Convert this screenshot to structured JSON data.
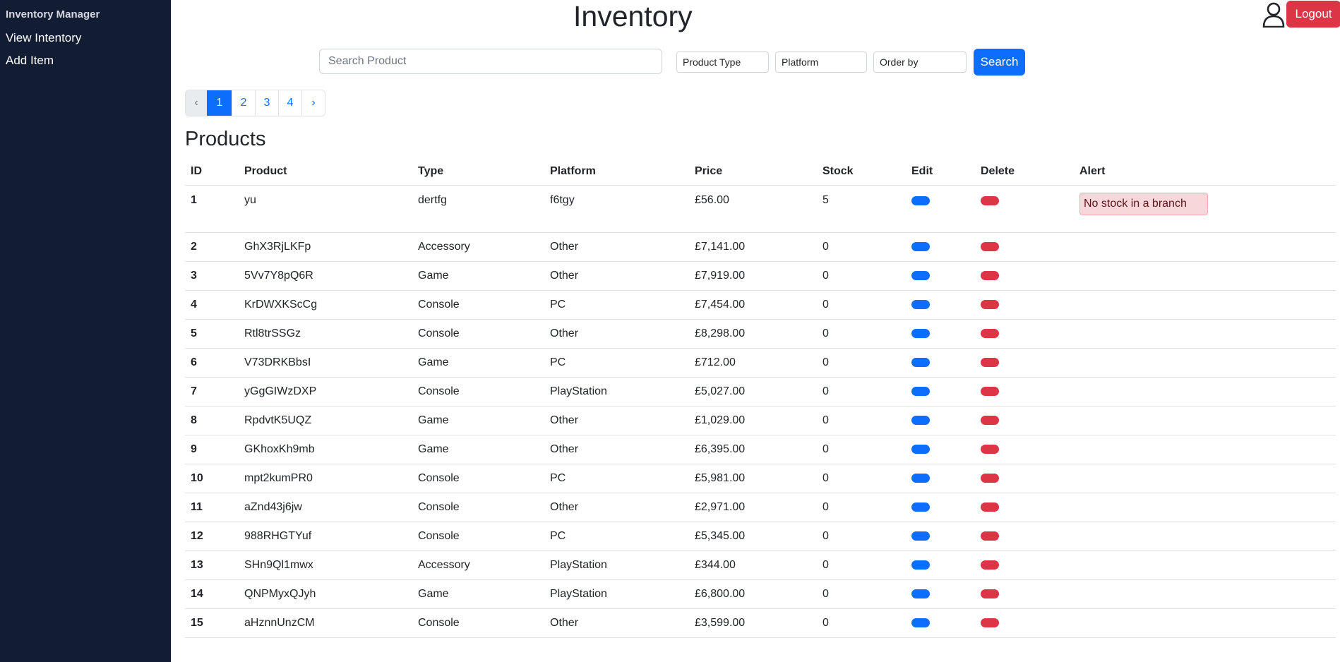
{
  "sidebar": {
    "brand": "Inventory Manager",
    "items": [
      {
        "label": "View Intentory"
      },
      {
        "label": "Add Item"
      }
    ]
  },
  "header": {
    "title": "Inventory",
    "user_icon": "person-icon",
    "logout_label": "Logout"
  },
  "search": {
    "placeholder": "Search Product",
    "value": "",
    "product_type": "Product Type",
    "platform": "Platform",
    "order_by": "Order by",
    "button_label": "Search"
  },
  "pagination": {
    "prev": "‹",
    "pages": [
      "1",
      "2",
      "3",
      "4"
    ],
    "active_page": "1",
    "next": "›"
  },
  "products": {
    "title": "Products",
    "columns": [
      "ID",
      "Product",
      "Type",
      "Platform",
      "Price",
      "Stock",
      "Edit",
      "Delete",
      "Alert"
    ],
    "rows": [
      {
        "id": "1",
        "product": "yu",
        "type": "dertfg",
        "platform": "f6tgy",
        "price": "£56.00",
        "stock": "5",
        "alert": "No stock in a branch"
      },
      {
        "id": "2",
        "product": "GhX3RjLKFp",
        "type": "Accessory",
        "platform": "Other",
        "price": "£7,141.00",
        "stock": "0",
        "alert": ""
      },
      {
        "id": "3",
        "product": "5Vv7Y8pQ6R",
        "type": "Game",
        "platform": "Other",
        "price": "£7,919.00",
        "stock": "0",
        "alert": ""
      },
      {
        "id": "4",
        "product": "KrDWXKScCg",
        "type": "Console",
        "platform": "PC",
        "price": "£7,454.00",
        "stock": "0",
        "alert": ""
      },
      {
        "id": "5",
        "product": "Rtl8trSSGz",
        "type": "Console",
        "platform": "Other",
        "price": "£8,298.00",
        "stock": "0",
        "alert": ""
      },
      {
        "id": "6",
        "product": "V73DRKBbsI",
        "type": "Game",
        "platform": "PC",
        "price": "£712.00",
        "stock": "0",
        "alert": ""
      },
      {
        "id": "7",
        "product": "yGgGIWzDXP",
        "type": "Console",
        "platform": "PlayStation",
        "price": "£5,027.00",
        "stock": "0",
        "alert": ""
      },
      {
        "id": "8",
        "product": "RpdvtK5UQZ",
        "type": "Game",
        "platform": "Other",
        "price": "£1,029.00",
        "stock": "0",
        "alert": ""
      },
      {
        "id": "9",
        "product": "GKhoxKh9mb",
        "type": "Game",
        "platform": "Other",
        "price": "£6,395.00",
        "stock": "0",
        "alert": ""
      },
      {
        "id": "10",
        "product": "mpt2kumPR0",
        "type": "Console",
        "platform": "PC",
        "price": "£5,981.00",
        "stock": "0",
        "alert": ""
      },
      {
        "id": "11",
        "product": "aZnd43j6jw",
        "type": "Console",
        "platform": "Other",
        "price": "£2,971.00",
        "stock": "0",
        "alert": ""
      },
      {
        "id": "12",
        "product": "988RHGTYuf",
        "type": "Console",
        "platform": "PC",
        "price": "£5,345.00",
        "stock": "0",
        "alert": ""
      },
      {
        "id": "13",
        "product": "SHn9Ql1mwx",
        "type": "Accessory",
        "platform": "PlayStation",
        "price": "£344.00",
        "stock": "0",
        "alert": ""
      },
      {
        "id": "14",
        "product": "QNPMyxQJyh",
        "type": "Game",
        "platform": "PlayStation",
        "price": "£6,800.00",
        "stock": "0",
        "alert": ""
      },
      {
        "id": "15",
        "product": "aHznnUnzCM",
        "type": "Console",
        "platform": "Other",
        "price": "£3,599.00",
        "stock": "0",
        "alert": ""
      }
    ]
  },
  "colors": {
    "sidebar_bg": "#121c33",
    "primary": "#0d6efd",
    "danger": "#dc3545",
    "alert_bg": "#f8d7da"
  }
}
